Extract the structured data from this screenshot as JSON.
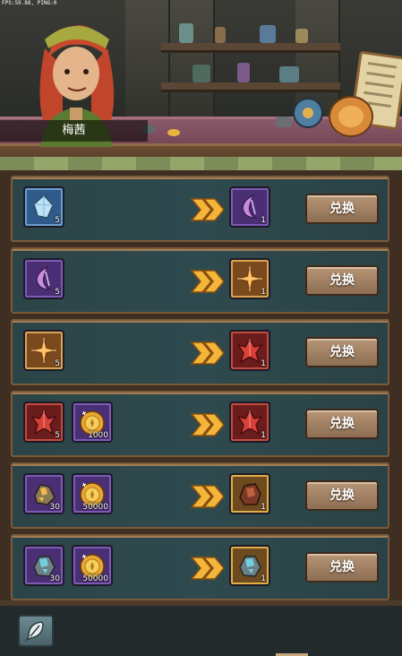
{
  "debug": {
    "fps_text": "FPS:59.88, PING:0"
  },
  "npc": {
    "name": "梅茜"
  },
  "exchange": {
    "button_label": "兑换",
    "rows": [
      {
        "inputs": [
          {
            "icon": "blue-crystal-icon",
            "frame": "blue",
            "count": "5"
          }
        ],
        "output": {
          "icon": "purple-crystal-icon",
          "frame": "purple",
          "count": "1"
        }
      },
      {
        "inputs": [
          {
            "icon": "purple-crystal-icon",
            "frame": "purple",
            "count": "5"
          }
        ],
        "output": {
          "icon": "orange-crystal-icon",
          "frame": "orange",
          "count": "1"
        }
      },
      {
        "inputs": [
          {
            "icon": "orange-crystal-icon",
            "frame": "orange",
            "count": "5"
          }
        ],
        "output": {
          "icon": "red-crystal-icon",
          "frame": "red",
          "count": "1"
        }
      },
      {
        "inputs": [
          {
            "icon": "red-crystal-icon",
            "frame": "red",
            "count": "5"
          },
          {
            "icon": "gold-coin-icon",
            "frame": "purple",
            "count": "1000"
          }
        ],
        "output": {
          "icon": "red-crystal-icon",
          "frame": "red",
          "count": "1"
        }
      },
      {
        "inputs": [
          {
            "icon": "gold-ore-icon",
            "frame": "purple",
            "count": "30"
          },
          {
            "icon": "gold-coin-icon",
            "frame": "purple",
            "count": "50000"
          }
        ],
        "output": {
          "icon": "red-ore-icon",
          "frame": "gold",
          "count": "1"
        }
      },
      {
        "inputs": [
          {
            "icon": "blue-ore-icon",
            "frame": "purple",
            "count": "30"
          },
          {
            "icon": "gold-coin-icon",
            "frame": "purple",
            "count": "50000"
          }
        ],
        "output": {
          "icon": "blue-ore-icon",
          "frame": "gold",
          "count": "1"
        }
      }
    ]
  },
  "bottom": {
    "side_button_icon": "feather-icon"
  },
  "colors": {
    "button": "#a5846a",
    "row_bg": "#2f4a4e",
    "frame_border": "#7a5a3b",
    "arrow": "#f3b53a"
  }
}
